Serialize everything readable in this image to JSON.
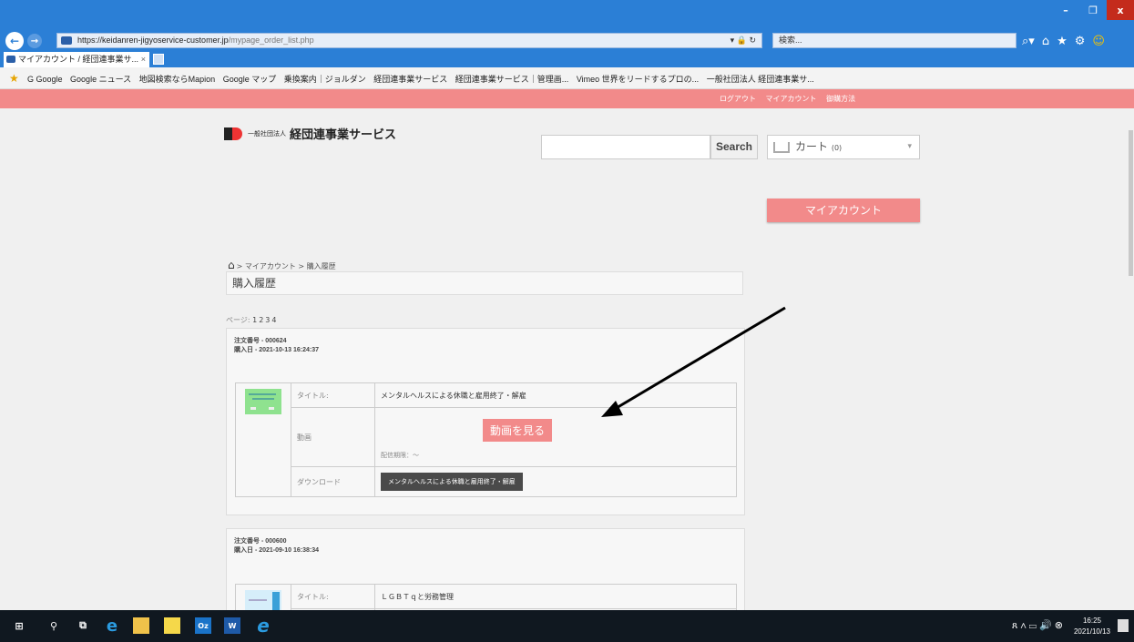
{
  "browser": {
    "url_domain": "https://keidanren-jigyoservice-customer.jp",
    "url_path": "/mypage_order_list.php",
    "search_placeholder": "検索...",
    "tab_title": "マイアカウント / 経団連事業サ...",
    "tab_close": "×",
    "favorites": [
      "G Google",
      "Google ニュース",
      "地図検索ならMapion",
      "Google マップ",
      "乗換案内｜ジョルダン",
      "経団連事業サービス",
      "経団連事業サービス｜管理画...",
      "Vimeo 世界をリードするプロの...",
      "一般社団法人 経団連事業サ..."
    ]
  },
  "site": {
    "top_links": [
      "ログアウト",
      "マイアカウント",
      "御購方法"
    ],
    "logo_small": "一般社団法人",
    "logo_big": "経団連事業サービス",
    "search_button": "Search",
    "cart_label": "カート",
    "cart_count": "(0)",
    "myaccount_button": "マイアカウント",
    "breadcrumb": "> マイアカウント > 購入履歴",
    "page_title": "購入履歴",
    "pager_label": "ページ:",
    "pages": [
      "1",
      "2",
      "3",
      "4"
    ]
  },
  "orders": [
    {
      "order_number": "注文番号 - 000624",
      "purchase_date": "購入日 - 2021-10-13 16:24:37",
      "title_label": "タイトル:",
      "title": "メンタルヘルスによる休職と雇用終了・解雇",
      "video_label": "動画",
      "watch_button": "動画を見る",
      "delivery_period": "配信期限：～",
      "download_label": "ダウンロード",
      "download_button": "メンタルヘルスによる休職と雇用終了・解雇",
      "thumb_color": "#8fe28f"
    },
    {
      "order_number": "注文番号 - 000600",
      "purchase_date": "購入日 - 2021-09-10 16:38:34",
      "title_label": "タイトル:",
      "title": "ＬＧＢＴｑと労務管理",
      "thumb_color": "#d6eefa"
    }
  ],
  "taskbar": {
    "time": "16:25",
    "date": "2021/10/13"
  },
  "colors": {
    "accent_pink": "#f28a8a",
    "browser_blue": "#2b7fd6",
    "taskbar": "#101820"
  }
}
